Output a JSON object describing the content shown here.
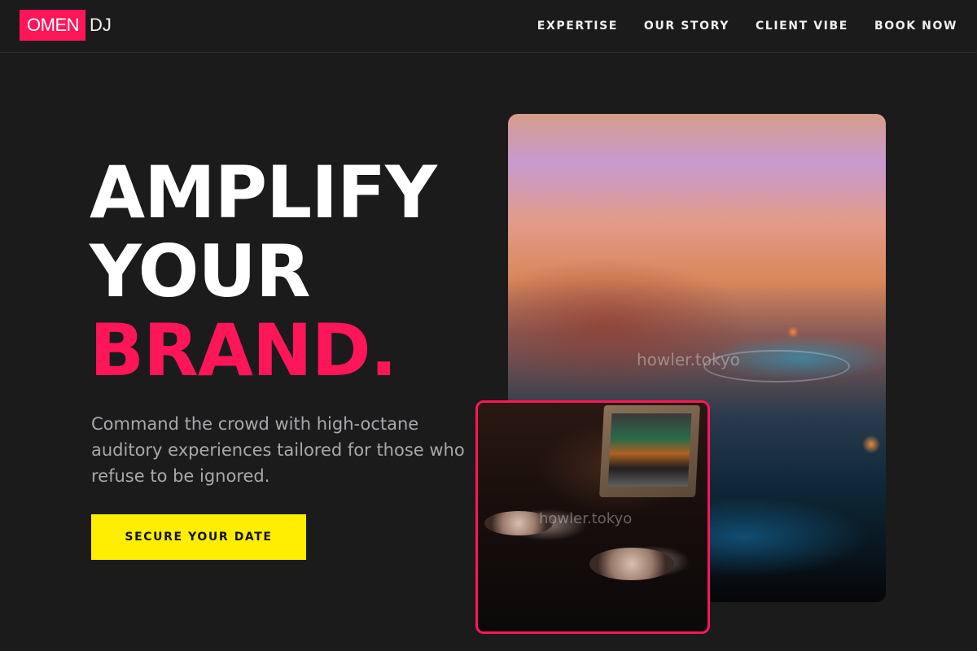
{
  "brand": {
    "logo_box": "OMEN",
    "logo_suffix": "DJ"
  },
  "nav": {
    "items": [
      {
        "label": "EXPERTISE"
      },
      {
        "label": "OUR STORY"
      },
      {
        "label": "CLIENT VIBE"
      },
      {
        "label": "BOOK NOW"
      }
    ]
  },
  "hero": {
    "line1": "AMPLIFY",
    "line2": "YOUR",
    "line3": "BRAND.",
    "tagline": "Command the crowd with high-octane auditory experiences tailored for those who refuse to be ignored.",
    "cta_label": "SECURE YOUR DATE"
  },
  "images": {
    "main_watermark": "howler.tokyo",
    "inset_watermark": "howler.tokyo"
  },
  "colors": {
    "background": "#1b1b1b",
    "accent_pink": "#ff1659",
    "cta_yellow": "#ffee00",
    "tagline_gray": "#a8a8ae"
  }
}
